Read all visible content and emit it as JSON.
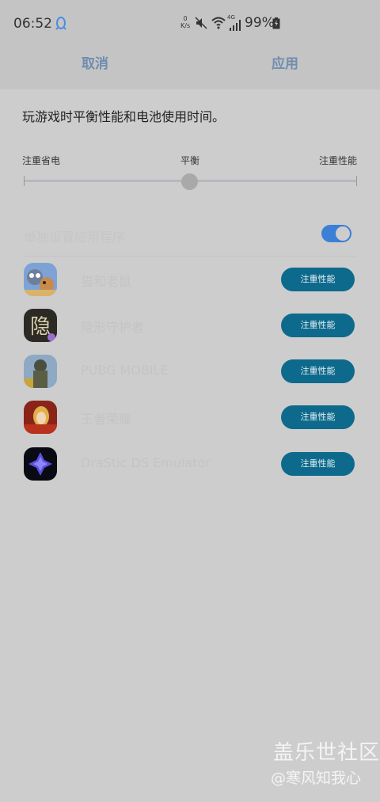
{
  "status_bar": {
    "time": "06:52",
    "net_speed_value": "0",
    "net_speed_unit": "K/s",
    "signal_label": "4G",
    "battery_percent": "99%"
  },
  "header": {
    "cancel_label": "取消",
    "apply_label": "应用"
  },
  "description": "玩游戏时平衡性能和电池使用时间。",
  "slider": {
    "left_label": "注重省电",
    "mid_label": "平衡",
    "right_label": "注重性能",
    "position": "平衡"
  },
  "toggle_row": {
    "label": "单独设置应用程序",
    "on": true
  },
  "apps": [
    {
      "name": "猫和老鼠",
      "mode_label": "注重性能",
      "icon": "tom-and-jerry-icon"
    },
    {
      "name": "隐形守护者",
      "mode_label": "注重性能",
      "icon": "yin-game-icon"
    },
    {
      "name": "PUBG MOBILE",
      "mode_label": "注重性能",
      "icon": "pubg-icon"
    },
    {
      "name": "王者荣耀",
      "mode_label": "注重性能",
      "icon": "honor-of-kings-icon"
    },
    {
      "name": "DraStic DS Emulator",
      "mode_label": "注重性能",
      "icon": "drastic-emulator-icon"
    }
  ],
  "watermark": {
    "line1": "盖乐世社区",
    "line2": "@寒风知我心"
  },
  "colors": {
    "accent_blue": "#3b7fd6",
    "button_teal": "#0e6a8c",
    "header_text": "#6f8db0"
  }
}
